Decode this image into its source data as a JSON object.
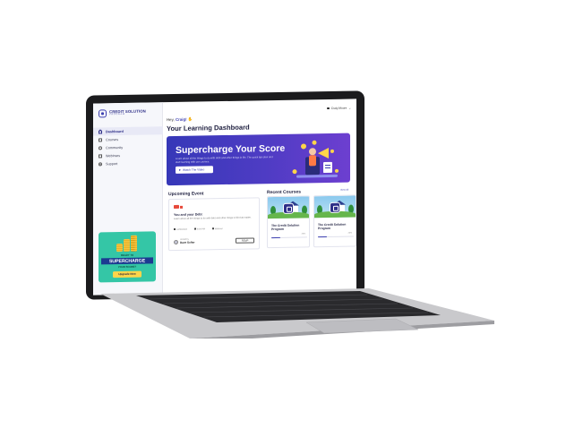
{
  "app": {
    "logo_title": "CREDIT SOLUTION",
    "logo_subtitle": "PROGRAM"
  },
  "sidebar": {
    "items": [
      {
        "label": "Dashboard",
        "icon": "home-icon"
      },
      {
        "label": "Courses",
        "icon": "book-icon"
      },
      {
        "label": "Community",
        "icon": "users-icon"
      },
      {
        "label": "Webinars",
        "icon": "video-icon"
      },
      {
        "label": "Support",
        "icon": "help-icon"
      }
    ],
    "promo": {
      "line1": "READY TO",
      "line2": "SUPERCHARGE",
      "line3": "YOUR SCORE?",
      "button": "Upgrade Now"
    }
  },
  "header": {
    "user_name": "Craig Moore",
    "greeting_prefix": "Hey,",
    "greeting_name": "Craig!",
    "page_title": "Your Learning Dashboard"
  },
  "hero": {
    "title": "Supercharge Your Score",
    "description": "Learn about all the things to do with debt and other things in life. The quick tips plus and start learning with our courses.",
    "button": "Watch The Video"
  },
  "events": {
    "heading": "Upcoming Event",
    "title": "You and your Debt",
    "description": "Learn about all the things to do with debt and other things in life that matter.",
    "meta": [
      "12/06/2024",
      "8:00 PM",
      "Webinar"
    ],
    "host_label": "Hosted by",
    "host_name": "Dave Sofier",
    "rsvp": "RSVP"
  },
  "courses": {
    "heading": "Recent Courses",
    "view_all": "View All",
    "items": [
      {
        "title": "The Credit Solution Program",
        "progress": "25%",
        "progress_value": 0.25
      },
      {
        "title": "The Credit Solution Program",
        "progress": "25%",
        "progress_value": 0.25
      }
    ]
  },
  "colors": {
    "brand": "#3c3fb0",
    "hero_start": "#3638b8",
    "hero_end": "#6d3fd0",
    "promo_bg": "#34c6a6",
    "event_badge": "#e7493a"
  }
}
